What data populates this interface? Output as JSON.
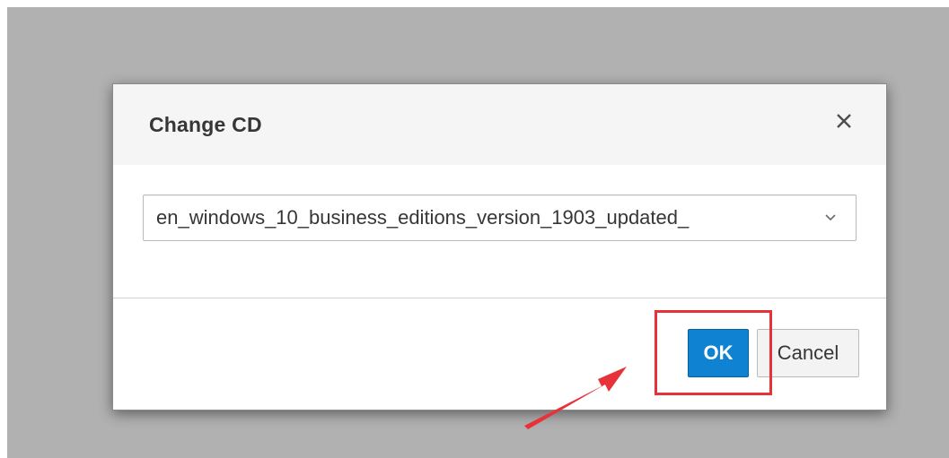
{
  "dialog": {
    "title": "Change CD",
    "close_icon": "close-icon",
    "cd_select": {
      "selected_value": "en_windows_10_business_editions_version_1903_updated_",
      "chevron_icon": "chevron-down-icon"
    },
    "buttons": {
      "ok_label": "OK",
      "cancel_label": "Cancel"
    }
  },
  "annotation": {
    "highlight_color": "#e8323a",
    "arrow_icon": "arrow-pointer-icon"
  },
  "colors": {
    "primary": "#0f82d1",
    "backdrop": "#b1b1b1"
  }
}
